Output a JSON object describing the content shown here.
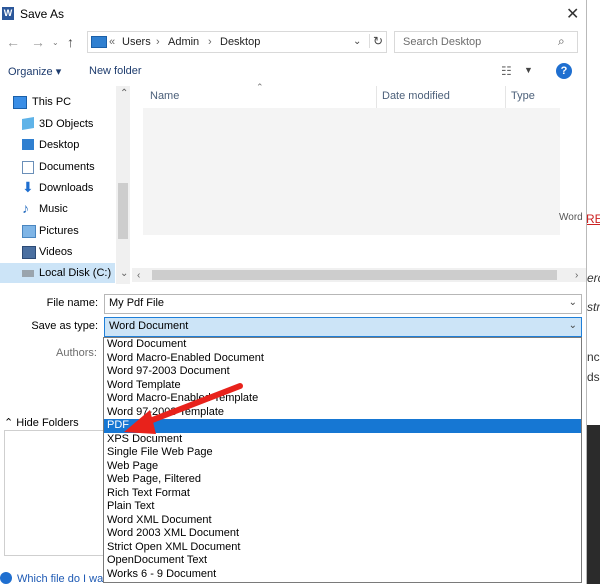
{
  "window": {
    "title": "Save As",
    "app_icon": "W"
  },
  "nav": {
    "back": "←",
    "forward": "→",
    "up": "↑",
    "breadcrumb": [
      "«",
      "Users",
      "›",
      "Admin",
      "›",
      "Desktop"
    ],
    "search_placeholder": "Search Desktop"
  },
  "toolbar": {
    "organize": "Organize ▾",
    "new_folder": "New folder",
    "help": "?"
  },
  "sidebar": {
    "items": [
      {
        "label": "This PC",
        "icon": "computer-icon"
      },
      {
        "label": "3D Objects",
        "icon": "cube-icon"
      },
      {
        "label": "Desktop",
        "icon": "desktop-icon"
      },
      {
        "label": "Documents",
        "icon": "document-icon"
      },
      {
        "label": "Downloads",
        "icon": "download-icon"
      },
      {
        "label": "Music",
        "icon": "music-icon"
      },
      {
        "label": "Pictures",
        "icon": "pictures-icon"
      },
      {
        "label": "Videos",
        "icon": "video-icon"
      },
      {
        "label": "Local Disk (C:)",
        "icon": "drive-icon"
      }
    ]
  },
  "filelist": {
    "columns": [
      "Name",
      "Date modified",
      "Type"
    ]
  },
  "fields": {
    "file_name_label": "File name:",
    "file_name_value": "My Pdf File",
    "save_as_type_label": "Save as type:",
    "save_as_type_value": "Word Document",
    "authors_label": "Authors:"
  },
  "dropdown_options": [
    "Word Document",
    "Word Macro-Enabled Document",
    "Word 97-2003 Document",
    "Word Template",
    "Word Macro-Enabled Template",
    "Word 97-2003 Template",
    "PDF",
    "XPS Document",
    "Single File Web Page",
    "Web Page",
    "Web Page, Filtered",
    "Rich Text Format",
    "Plain Text",
    "Word XML Document",
    "Word 2003 XML Document",
    "Strict Open XML Document",
    "OpenDocument Text",
    "Works 6 - 9 Document"
  ],
  "selected_option": "PDF",
  "hide_folders": "Hide Folders",
  "help_link": "Which file do I want to save?",
  "background_fragments": {
    "word": "Word",
    "rb": "RE",
    "erc": "erc",
    "str": "str",
    "ncl": "ncl",
    "ds": "ds,"
  },
  "colors": {
    "accent": "#1677d3",
    "arrow": "#e8221b"
  }
}
